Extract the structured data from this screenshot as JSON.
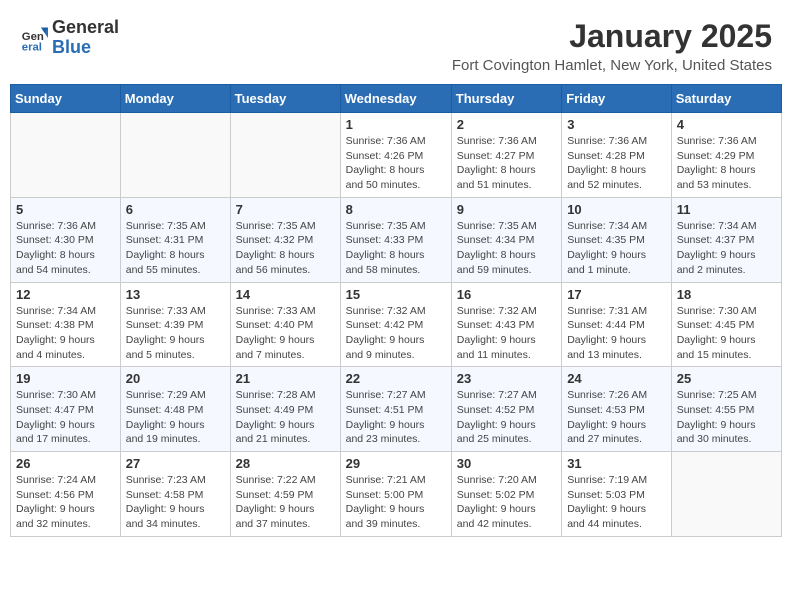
{
  "header": {
    "logo_general": "General",
    "logo_blue": "Blue",
    "month": "January 2025",
    "location": "Fort Covington Hamlet, New York, United States"
  },
  "days_of_week": [
    "Sunday",
    "Monday",
    "Tuesday",
    "Wednesday",
    "Thursday",
    "Friday",
    "Saturday"
  ],
  "weeks": [
    [
      {
        "day": "",
        "info": ""
      },
      {
        "day": "",
        "info": ""
      },
      {
        "day": "",
        "info": ""
      },
      {
        "day": "1",
        "info": "Sunrise: 7:36 AM\nSunset: 4:26 PM\nDaylight: 8 hours\nand 50 minutes."
      },
      {
        "day": "2",
        "info": "Sunrise: 7:36 AM\nSunset: 4:27 PM\nDaylight: 8 hours\nand 51 minutes."
      },
      {
        "day": "3",
        "info": "Sunrise: 7:36 AM\nSunset: 4:28 PM\nDaylight: 8 hours\nand 52 minutes."
      },
      {
        "day": "4",
        "info": "Sunrise: 7:36 AM\nSunset: 4:29 PM\nDaylight: 8 hours\nand 53 minutes."
      }
    ],
    [
      {
        "day": "5",
        "info": "Sunrise: 7:36 AM\nSunset: 4:30 PM\nDaylight: 8 hours\nand 54 minutes."
      },
      {
        "day": "6",
        "info": "Sunrise: 7:35 AM\nSunset: 4:31 PM\nDaylight: 8 hours\nand 55 minutes."
      },
      {
        "day": "7",
        "info": "Sunrise: 7:35 AM\nSunset: 4:32 PM\nDaylight: 8 hours\nand 56 minutes."
      },
      {
        "day": "8",
        "info": "Sunrise: 7:35 AM\nSunset: 4:33 PM\nDaylight: 8 hours\nand 58 minutes."
      },
      {
        "day": "9",
        "info": "Sunrise: 7:35 AM\nSunset: 4:34 PM\nDaylight: 8 hours\nand 59 minutes."
      },
      {
        "day": "10",
        "info": "Sunrise: 7:34 AM\nSunset: 4:35 PM\nDaylight: 9 hours\nand 1 minute."
      },
      {
        "day": "11",
        "info": "Sunrise: 7:34 AM\nSunset: 4:37 PM\nDaylight: 9 hours\nand 2 minutes."
      }
    ],
    [
      {
        "day": "12",
        "info": "Sunrise: 7:34 AM\nSunset: 4:38 PM\nDaylight: 9 hours\nand 4 minutes."
      },
      {
        "day": "13",
        "info": "Sunrise: 7:33 AM\nSunset: 4:39 PM\nDaylight: 9 hours\nand 5 minutes."
      },
      {
        "day": "14",
        "info": "Sunrise: 7:33 AM\nSunset: 4:40 PM\nDaylight: 9 hours\nand 7 minutes."
      },
      {
        "day": "15",
        "info": "Sunrise: 7:32 AM\nSunset: 4:42 PM\nDaylight: 9 hours\nand 9 minutes."
      },
      {
        "day": "16",
        "info": "Sunrise: 7:32 AM\nSunset: 4:43 PM\nDaylight: 9 hours\nand 11 minutes."
      },
      {
        "day": "17",
        "info": "Sunrise: 7:31 AM\nSunset: 4:44 PM\nDaylight: 9 hours\nand 13 minutes."
      },
      {
        "day": "18",
        "info": "Sunrise: 7:30 AM\nSunset: 4:45 PM\nDaylight: 9 hours\nand 15 minutes."
      }
    ],
    [
      {
        "day": "19",
        "info": "Sunrise: 7:30 AM\nSunset: 4:47 PM\nDaylight: 9 hours\nand 17 minutes."
      },
      {
        "day": "20",
        "info": "Sunrise: 7:29 AM\nSunset: 4:48 PM\nDaylight: 9 hours\nand 19 minutes."
      },
      {
        "day": "21",
        "info": "Sunrise: 7:28 AM\nSunset: 4:49 PM\nDaylight: 9 hours\nand 21 minutes."
      },
      {
        "day": "22",
        "info": "Sunrise: 7:27 AM\nSunset: 4:51 PM\nDaylight: 9 hours\nand 23 minutes."
      },
      {
        "day": "23",
        "info": "Sunrise: 7:27 AM\nSunset: 4:52 PM\nDaylight: 9 hours\nand 25 minutes."
      },
      {
        "day": "24",
        "info": "Sunrise: 7:26 AM\nSunset: 4:53 PM\nDaylight: 9 hours\nand 27 minutes."
      },
      {
        "day": "25",
        "info": "Sunrise: 7:25 AM\nSunset: 4:55 PM\nDaylight: 9 hours\nand 30 minutes."
      }
    ],
    [
      {
        "day": "26",
        "info": "Sunrise: 7:24 AM\nSunset: 4:56 PM\nDaylight: 9 hours\nand 32 minutes."
      },
      {
        "day": "27",
        "info": "Sunrise: 7:23 AM\nSunset: 4:58 PM\nDaylight: 9 hours\nand 34 minutes."
      },
      {
        "day": "28",
        "info": "Sunrise: 7:22 AM\nSunset: 4:59 PM\nDaylight: 9 hours\nand 37 minutes."
      },
      {
        "day": "29",
        "info": "Sunrise: 7:21 AM\nSunset: 5:00 PM\nDaylight: 9 hours\nand 39 minutes."
      },
      {
        "day": "30",
        "info": "Sunrise: 7:20 AM\nSunset: 5:02 PM\nDaylight: 9 hours\nand 42 minutes."
      },
      {
        "day": "31",
        "info": "Sunrise: 7:19 AM\nSunset: 5:03 PM\nDaylight: 9 hours\nand 44 minutes."
      },
      {
        "day": "",
        "info": ""
      }
    ]
  ]
}
